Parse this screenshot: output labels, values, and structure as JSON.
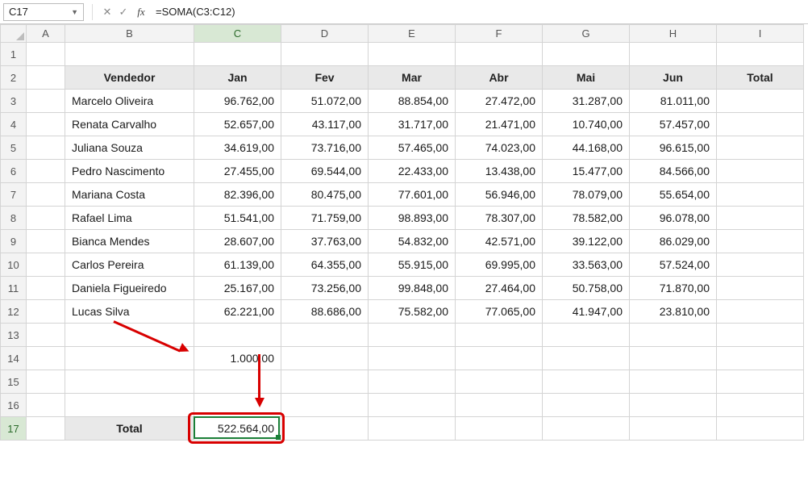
{
  "name_box": "C17",
  "formula": "=SOMA(C3:C12)",
  "cols": [
    "A",
    "B",
    "C",
    "D",
    "E",
    "F",
    "G",
    "H",
    "I"
  ],
  "rows": [
    "1",
    "2",
    "3",
    "4",
    "5",
    "6",
    "7",
    "8",
    "9",
    "10",
    "11",
    "12",
    "13",
    "14",
    "15",
    "16",
    "17"
  ],
  "headers": {
    "vendedor": "Vendedor",
    "jan": "Jan",
    "fev": "Fev",
    "mar": "Mar",
    "abr": "Abr",
    "mai": "Mai",
    "jun": "Jun",
    "total": "Total",
    "total_row": "Total"
  },
  "d": [
    {
      "n": "Marcelo Oliveira",
      "v": [
        "96.762,00",
        "51.072,00",
        "88.854,00",
        "27.472,00",
        "31.287,00",
        "81.011,00"
      ]
    },
    {
      "n": "Renata Carvalho",
      "v": [
        "52.657,00",
        "43.117,00",
        "31.717,00",
        "21.471,00",
        "10.740,00",
        "57.457,00"
      ]
    },
    {
      "n": "Juliana Souza",
      "v": [
        "34.619,00",
        "73.716,00",
        "57.465,00",
        "74.023,00",
        "44.168,00",
        "96.615,00"
      ]
    },
    {
      "n": "Pedro Nascimento",
      "v": [
        "27.455,00",
        "69.544,00",
        "22.433,00",
        "13.438,00",
        "15.477,00",
        "84.566,00"
      ]
    },
    {
      "n": "Mariana Costa",
      "v": [
        "82.396,00",
        "80.475,00",
        "77.601,00",
        "56.946,00",
        "78.079,00",
        "55.654,00"
      ]
    },
    {
      "n": "Rafael Lima",
      "v": [
        "51.541,00",
        "71.759,00",
        "98.893,00",
        "78.307,00",
        "78.582,00",
        "96.078,00"
      ]
    },
    {
      "n": "Bianca Mendes",
      "v": [
        "28.607,00",
        "37.763,00",
        "54.832,00",
        "42.571,00",
        "39.122,00",
        "86.029,00"
      ]
    },
    {
      "n": "Carlos Pereira",
      "v": [
        "61.139,00",
        "64.355,00",
        "55.915,00",
        "69.995,00",
        "33.563,00",
        "57.524,00"
      ]
    },
    {
      "n": "Daniela Figueiredo",
      "v": [
        "25.167,00",
        "73.256,00",
        "99.848,00",
        "27.464,00",
        "50.758,00",
        "71.870,00"
      ]
    },
    {
      "n": "Lucas Silva",
      "v": [
        "62.221,00",
        "88.686,00",
        "75.582,00",
        "77.065,00",
        "41.947,00",
        "23.810,00"
      ]
    }
  ],
  "extra_c14": "1.000,00",
  "total_c17": "522.564,00"
}
